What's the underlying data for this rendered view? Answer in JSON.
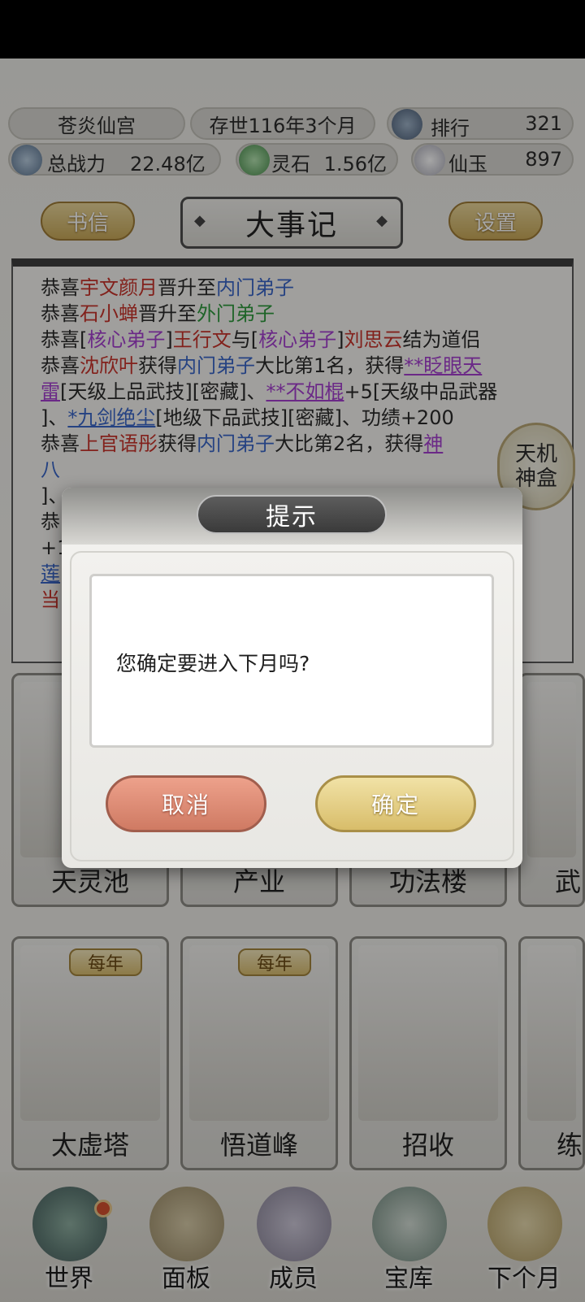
{
  "top_bar": {
    "sect_name": "苍炎仙宫",
    "time_label": "存世116年3个月",
    "rank_label": "排行",
    "rank_value": "321",
    "power_label": "总战力",
    "power_value": "22.48亿",
    "stone_label": "灵石",
    "stone_value": "1.56亿",
    "jade_label": "仙玉",
    "jade_value": "897"
  },
  "header": {
    "letters_label": "书信",
    "title": "大事记",
    "settings_label": "设置"
  },
  "log": {
    "lines": [
      {
        "segs": [
          {
            "t": "恭喜",
            "c": ""
          },
          {
            "t": "宇文颜月",
            "c": "red"
          },
          {
            "t": "晋升至",
            "c": ""
          },
          {
            "t": "内门弟子",
            "c": "blu"
          }
        ]
      },
      {
        "segs": [
          {
            "t": "恭喜",
            "c": ""
          },
          {
            "t": "石小蝉",
            "c": "red"
          },
          {
            "t": "晋升至",
            "c": ""
          },
          {
            "t": "外门弟子",
            "c": "grn"
          }
        ]
      },
      {
        "segs": [
          {
            "t": "恭喜[",
            "c": ""
          },
          {
            "t": "核心弟子",
            "c": "pur"
          },
          {
            "t": "]",
            "c": ""
          },
          {
            "t": "王行文",
            "c": "red"
          },
          {
            "t": "与[",
            "c": ""
          },
          {
            "t": "核心弟子",
            "c": "pur"
          },
          {
            "t": "]",
            "c": ""
          },
          {
            "t": "刘思云",
            "c": "red"
          },
          {
            "t": "结为道侣",
            "c": ""
          }
        ]
      },
      {
        "segs": [
          {
            "t": "恭喜",
            "c": ""
          },
          {
            "t": "沈欣叶",
            "c": "red"
          },
          {
            "t": "获得",
            "c": ""
          },
          {
            "t": "内门弟子",
            "c": "blu"
          },
          {
            "t": "大比第1名，获得",
            "c": ""
          },
          {
            "t": "**眨眼天",
            "c": "pur ul"
          }
        ]
      },
      {
        "segs": [
          {
            "t": "雷",
            "c": "pur ul"
          },
          {
            "t": "[天级上品武技][密藏]、",
            "c": ""
          },
          {
            "t": "**不如棍",
            "c": "pur ul"
          },
          {
            "t": "+5[天级中品武器",
            "c": ""
          }
        ]
      },
      {
        "segs": [
          {
            "t": "]、",
            "c": ""
          },
          {
            "t": "*九剑绝尘",
            "c": "blu ul"
          },
          {
            "t": "[地级下品武技][密藏]、功绩+200",
            "c": ""
          }
        ]
      },
      {
        "segs": [
          {
            "t": "恭喜",
            "c": ""
          },
          {
            "t": "上官语彤",
            "c": "red"
          },
          {
            "t": "获得",
            "c": ""
          },
          {
            "t": "内门弟子",
            "c": "blu"
          },
          {
            "t": "大比第2名，获得",
            "c": ""
          },
          {
            "t": "神",
            "c": "pur ul"
          }
        ]
      },
      {
        "segs": [
          {
            "t": "八",
            "c": "blu"
          }
        ]
      },
      {
        "segs": [
          {
            "t": "]、",
            "c": ""
          }
        ]
      },
      {
        "segs": [
          {
            "t": "恭",
            "c": ""
          }
        ]
      },
      {
        "segs": [
          {
            "t": "+1",
            "c": ""
          }
        ]
      },
      {
        "segs": [
          {
            "t": "莲",
            "c": "blu ul"
          }
        ]
      },
      {
        "segs": [
          {
            "t": "当",
            "c": "red"
          }
        ]
      }
    ]
  },
  "side_badge": {
    "line1": "天机",
    "line2": "神盒"
  },
  "buildings_row1": [
    {
      "name": "天灵池",
      "badge": ""
    },
    {
      "name": "产业",
      "badge": ""
    },
    {
      "name": "功法楼",
      "badge": ""
    },
    {
      "name": "武",
      "badge": ""
    }
  ],
  "buildings_row2": [
    {
      "name": "太虚塔",
      "badge": "每年"
    },
    {
      "name": "悟道峰",
      "badge": "每年"
    },
    {
      "name": "招收",
      "badge": ""
    },
    {
      "name": "练",
      "badge": ""
    }
  ],
  "nav": {
    "world": "世界",
    "panel": "面板",
    "members": "成员",
    "treasury": "宝库",
    "next_month": "下个月"
  },
  "dialog": {
    "title": "提示",
    "message": "您确定要进入下月吗?",
    "cancel_label": "取消",
    "confirm_label": "确定"
  }
}
